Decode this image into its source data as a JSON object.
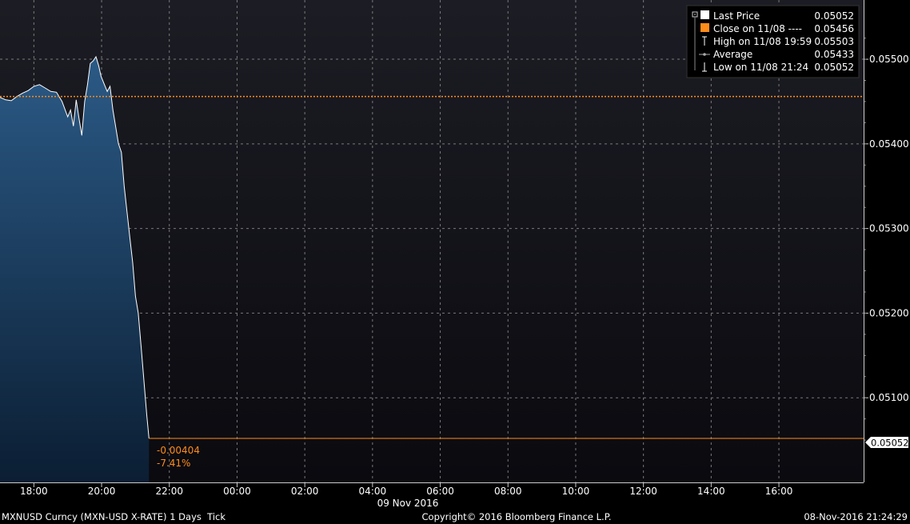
{
  "chart_data": {
    "type": "area",
    "ylim": [
      0.05,
      0.0557
    ],
    "y_ticks": [
      "0.05100",
      "0.05200",
      "0.05300",
      "0.05400",
      "0.05500"
    ],
    "x_ticks": [
      "18:00",
      "20:00",
      "22:00",
      "00:00",
      "02:00",
      "04:00",
      "06:00",
      "08:00",
      "10:00",
      "12:00",
      "14:00",
      "16:00"
    ],
    "x_date_label": "09 Nov 2016",
    "grid": true,
    "series": [
      {
        "name": "Last Price",
        "x": [
          "17:00",
          "17:10",
          "17:20",
          "17:30",
          "17:40",
          "17:50",
          "18:00",
          "18:10",
          "18:20",
          "18:30",
          "18:40",
          "18:50",
          "19:00",
          "19:05",
          "19:10",
          "19:15",
          "19:20",
          "19:25",
          "19:30",
          "19:35",
          "19:40",
          "19:45",
          "19:50",
          "19:55",
          "19:59",
          "20:05",
          "20:10",
          "20:15",
          "20:20",
          "20:25",
          "20:30",
          "20:35",
          "20:40",
          "20:45",
          "20:50",
          "20:55",
          "21:00",
          "21:05",
          "21:10",
          "21:15",
          "21:20",
          "21:24"
        ],
        "values": [
          0.05455,
          0.05452,
          0.05451,
          0.05456,
          0.0546,
          0.05463,
          0.05468,
          0.0547,
          0.05466,
          0.05462,
          0.05461,
          0.0545,
          0.05432,
          0.0544,
          0.05421,
          0.05452,
          0.0543,
          0.0541,
          0.0545,
          0.0547,
          0.05495,
          0.05498,
          0.05503,
          0.05492,
          0.0548,
          0.0547,
          0.05462,
          0.05468,
          0.0544,
          0.0542,
          0.054,
          0.0539,
          0.0535,
          0.0532,
          0.0529,
          0.0526,
          0.0522,
          0.052,
          0.0516,
          0.0512,
          0.0508,
          0.05052
        ]
      }
    ],
    "close_line": {
      "label": "Close on 11/08",
      "value": 0.05456
    },
    "last_value_label": "0.05052",
    "change": {
      "abs": "-0.00404",
      "pct": "-7.41%"
    }
  },
  "legend": {
    "items": [
      {
        "label": "Last Price",
        "value": "0.05052"
      },
      {
        "label": "Close on 11/08 ----",
        "value": "0.05456"
      },
      {
        "label": "High on 11/08 19:59",
        "value": "0.05503"
      },
      {
        "label": "Average",
        "value": "0.05433"
      },
      {
        "label": "Low on 11/08 21:24",
        "value": "0.05052"
      }
    ]
  },
  "footer": {
    "left": "MXNUSD Curncy (MXN-USD X-RATE) 1 Days  Tick",
    "center": "Copyright© 2016 Bloomberg Finance L.P.",
    "right": "08-Nov-2016 21:24:29"
  },
  "colors": {
    "background": "#000000",
    "plot_bg_top": "#1c1c24",
    "plot_bg_bottom": "#0a0a0f",
    "area_top": "#2b5a86",
    "area_bottom": "#0b1e33",
    "line": "#ffffff",
    "close_line": "#ff8c1a",
    "grid": "#7a7a7a"
  }
}
